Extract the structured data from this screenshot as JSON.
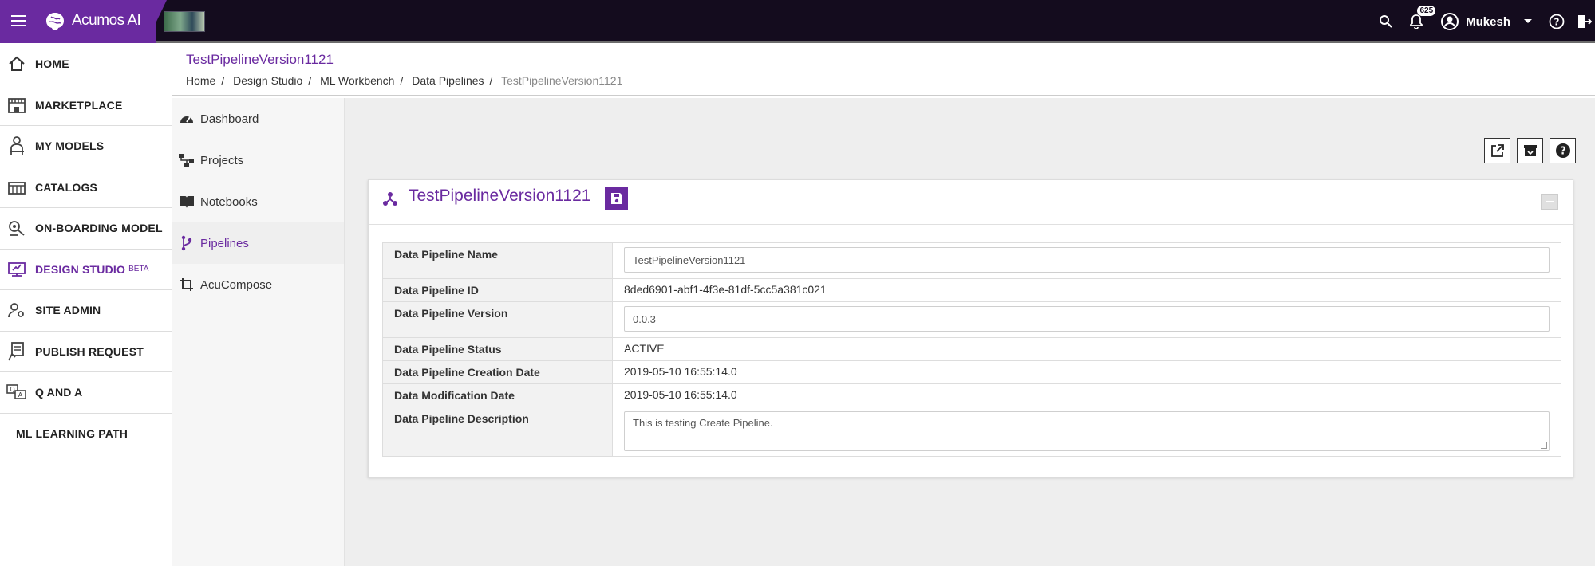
{
  "topbar": {
    "brand_name": "Acumos AI",
    "notification_count": "625",
    "username": "Mukesh",
    "icons": [
      "menu-icon",
      "search-icon",
      "bell-icon",
      "account-icon",
      "chevron-down-icon",
      "help-icon",
      "logout-icon"
    ]
  },
  "leftnav": {
    "items": [
      {
        "label": "HOME",
        "icon": "home-icon"
      },
      {
        "label": "MARKETPLACE",
        "icon": "marketplace-icon"
      },
      {
        "label": "MY MODELS",
        "icon": "models-icon"
      },
      {
        "label": "CATALOGS",
        "icon": "catalogs-icon"
      },
      {
        "label": "ON-BOARDING MODEL",
        "icon": "onboarding-icon"
      },
      {
        "label": "DESIGN STUDIO",
        "beta": "BETA",
        "icon": "design-studio-icon",
        "active": true
      },
      {
        "label": "SITE ADMIN",
        "icon": "site-admin-icon"
      },
      {
        "label": "PUBLISH REQUEST",
        "icon": "publish-icon"
      },
      {
        "label": "Q AND A",
        "icon": "qa-icon"
      },
      {
        "label": "ML LEARNING PATH",
        "icon": ""
      }
    ]
  },
  "header": {
    "title": "TestPipelineVersion1121",
    "breadcrumb": [
      "Home",
      "Design Studio",
      "ML Workbench",
      "Data Pipelines",
      "TestPipelineVersion1121"
    ]
  },
  "subnav": {
    "items": [
      {
        "label": "Dashboard",
        "icon": "dashboard-icon"
      },
      {
        "label": "Projects",
        "icon": "projects-icon"
      },
      {
        "label": "Notebooks",
        "icon": "notebook-icon"
      },
      {
        "label": "Pipelines",
        "icon": "pipeline-icon",
        "active": true
      },
      {
        "label": "AcuCompose",
        "icon": "crop-icon"
      }
    ]
  },
  "card": {
    "title": "TestPipelineVersion1121",
    "toolbar_icons": [
      "open-external-icon",
      "archive-icon",
      "help-icon"
    ],
    "fields": {
      "name_label": "Data Pipeline Name",
      "name_value": "TestPipelineVersion1121",
      "id_label": "Data Pipeline ID",
      "id_value": "8ded6901-abf1-4f3e-81df-5cc5a381c021",
      "version_label": "Data Pipeline Version",
      "version_value": "0.0.3",
      "status_label": "Data Pipeline Status",
      "status_value": "ACTIVE",
      "creation_label": "Data Pipeline Creation Date",
      "creation_value": "2019-05-10 16:55:14.0",
      "modification_label": "Data Modification Date",
      "modification_value": "2019-05-10 16:55:14.0",
      "description_label": "Data Pipeline Description",
      "description_value": "This is testing Create Pipeline."
    }
  },
  "colors": {
    "accent": "#6a2aa0",
    "topbar": "#140c1e",
    "status_active": "#2e8b2e"
  }
}
